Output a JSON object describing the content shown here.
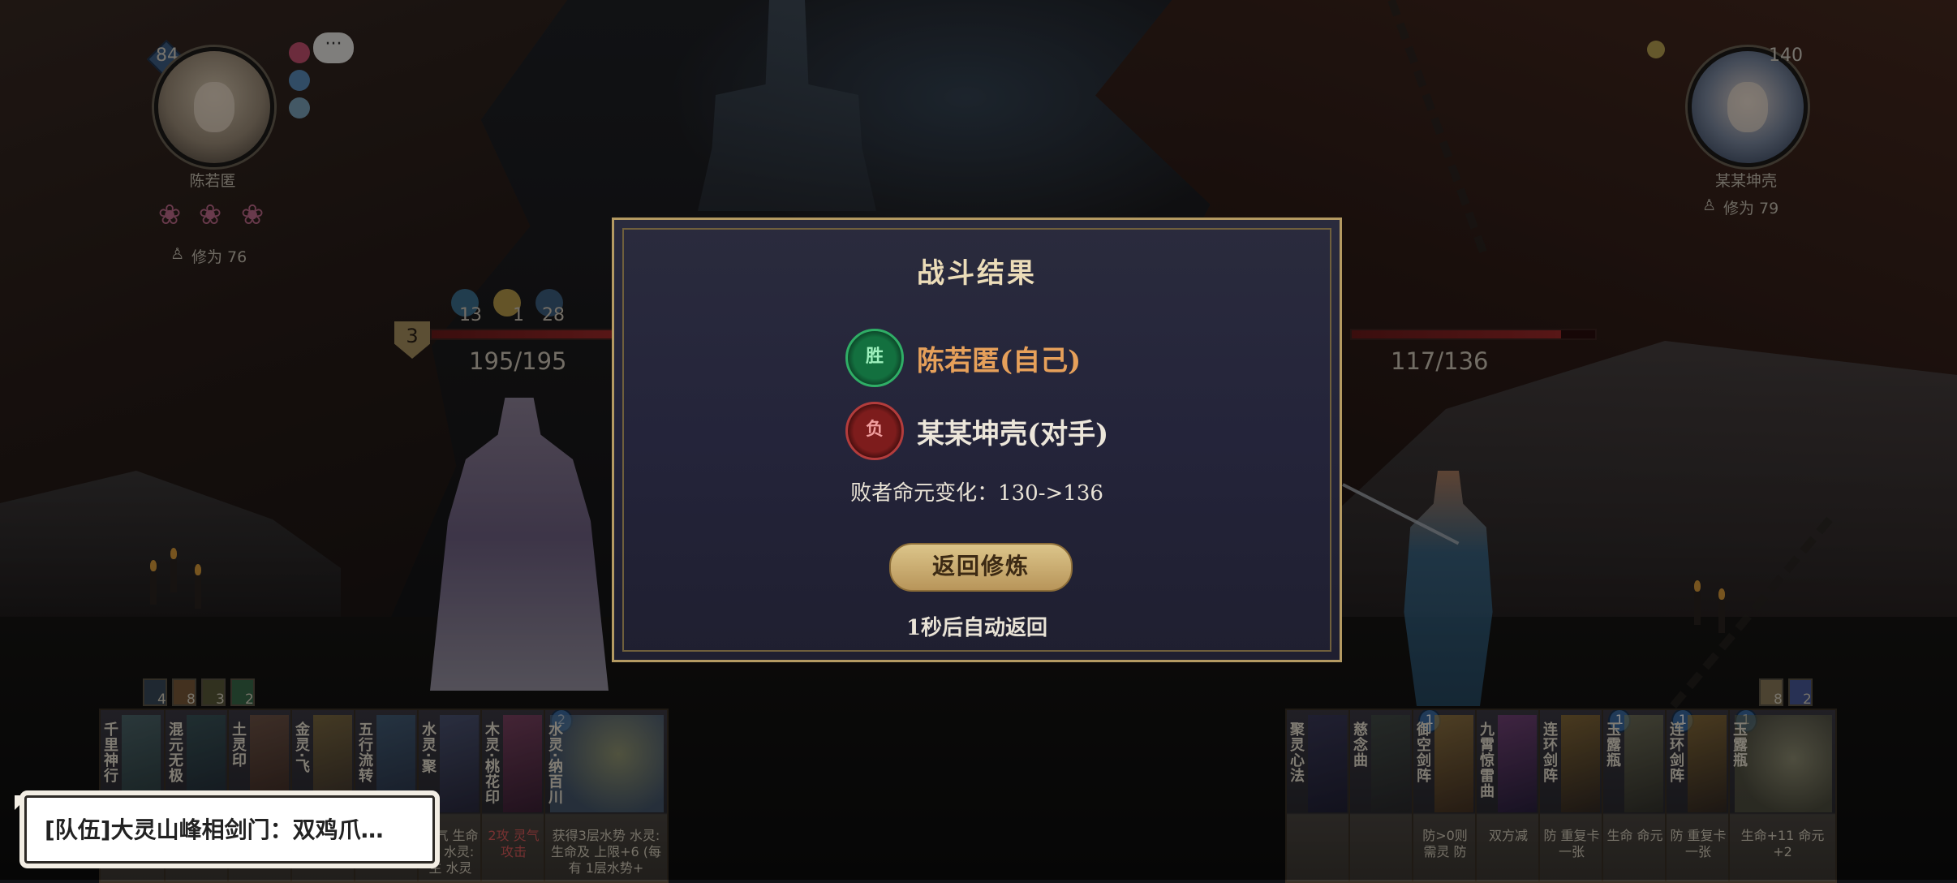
{
  "player": {
    "level": "84",
    "name": "陈若匿",
    "cultivation": "修为 76",
    "hp": "195/195",
    "hp_fraction": 1.0,
    "shield": "3",
    "stats": [
      "13",
      "1",
      "28"
    ],
    "deck_counts": [
      "4",
      "8",
      "3",
      "2"
    ]
  },
  "opponent": {
    "level": "140",
    "name": "某某坤壳",
    "cultivation": "修为 79",
    "hp": "117/136",
    "hp_fraction": 0.86,
    "deck_counts": [
      "8",
      "2"
    ]
  },
  "icons": {
    "chat": "chat-bubble-icon",
    "lotus": "lotus-icon",
    "cultivation": "meditation-icon"
  },
  "player_cards": [
    {
      "name": "千里神行",
      "desc": ""
    },
    {
      "name": "混元无极",
      "desc": ""
    },
    {
      "name": "土灵印",
      "desc": ""
    },
    {
      "name": "金灵·飞",
      "desc": ""
    },
    {
      "name": "五行流转",
      "desc": ""
    },
    {
      "name": "水灵·聚",
      "desc": "灵气 生命及 水灵: 生 水灵"
    },
    {
      "name": "木灵·桃花印",
      "desc": "2攻 灵气 攻击"
    },
    {
      "name": "水灵·纳百川",
      "desc": "获得3层水势 水灵: 生命及 上限+6 (每有 1层水势+"
    }
  ],
  "opponent_cards": [
    {
      "name": "聚灵心法",
      "desc": ""
    },
    {
      "name": "慈念曲",
      "desc": ""
    },
    {
      "name": "御空剑阵",
      "desc": "防>0则 需灵 防"
    },
    {
      "name": "九霄惊雷曲",
      "desc": "双方减"
    },
    {
      "name": "连环剑阵",
      "desc": "防 重复卡 一张"
    },
    {
      "name": "玉露瓶",
      "desc": "生命 命元"
    },
    {
      "name": "连环剑阵",
      "desc": "防 重复卡 一张"
    },
    {
      "name": "玉露瓶",
      "desc": "生命+11 命元+2"
    }
  ],
  "team_chat": "[队伍]大灵山峰相剑门：双鸡爪…",
  "result": {
    "title": "战斗结果",
    "winner_badge": "胜",
    "winner": "陈若匿(自己)",
    "loser_badge": "负",
    "loser": "某某坤壳(对手)",
    "change": "败者命元变化：130->136",
    "return_button": "返回修炼",
    "auto_return": "1秒后自动返回"
  },
  "colors": {
    "win_accent": "#e6a05a",
    "win_badge": "#13703f",
    "lose_badge": "#7d1c1c",
    "hp_bar": "#a12a2a",
    "button_gold": "#dcc58a",
    "frame_gold": "#b49a62"
  }
}
